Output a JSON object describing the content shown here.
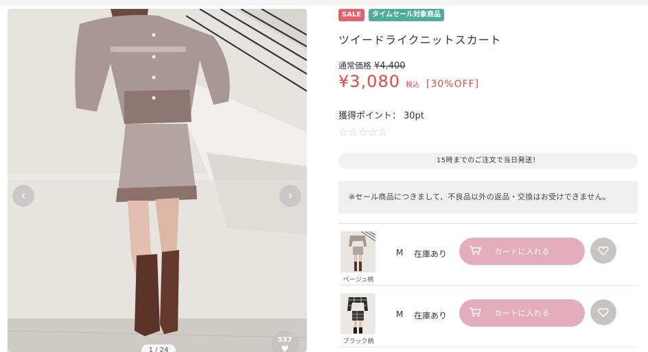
{
  "gallery": {
    "prev_icon": "chevron-left-icon",
    "next_icon": "chevron-right-icon",
    "counter": "1 / 24",
    "favorites_count": "537",
    "heart_icon": "heart-icon"
  },
  "product": {
    "badges": {
      "sale": "SALE",
      "time_sale": "タイムセール対象商品"
    },
    "title": "ツイードライクニットスカート",
    "regular_label": "通常価格",
    "regular_price": "¥4,400",
    "sale_price": "¥3,080",
    "tax_label": "税込",
    "discount": "[30%OFF]",
    "points_label": "獲得ポイント：",
    "points_value": "30pt",
    "rating_stars": "☆☆☆☆☆",
    "rating_value": 0,
    "shipping_note": "15時までのご注文で当日発送！",
    "notice": "※セール商品につきまして、不良品以外の返品・交換はお受けできません。"
  },
  "variants": [
    {
      "color": "ベージュ柄",
      "size": "M",
      "stock": "在庫あり",
      "cart_label": "カートに入れる"
    },
    {
      "color": "ブラック柄",
      "size": "M",
      "stock": "在庫あり",
      "cart_label": "カートに入れる"
    }
  ],
  "colors": {
    "sale_badge": "#e8606a",
    "time_badge": "#4cae9a",
    "price_red": "#e54545",
    "cart_pink": "#e4adbb",
    "star_pink": "#f0b4c5"
  }
}
